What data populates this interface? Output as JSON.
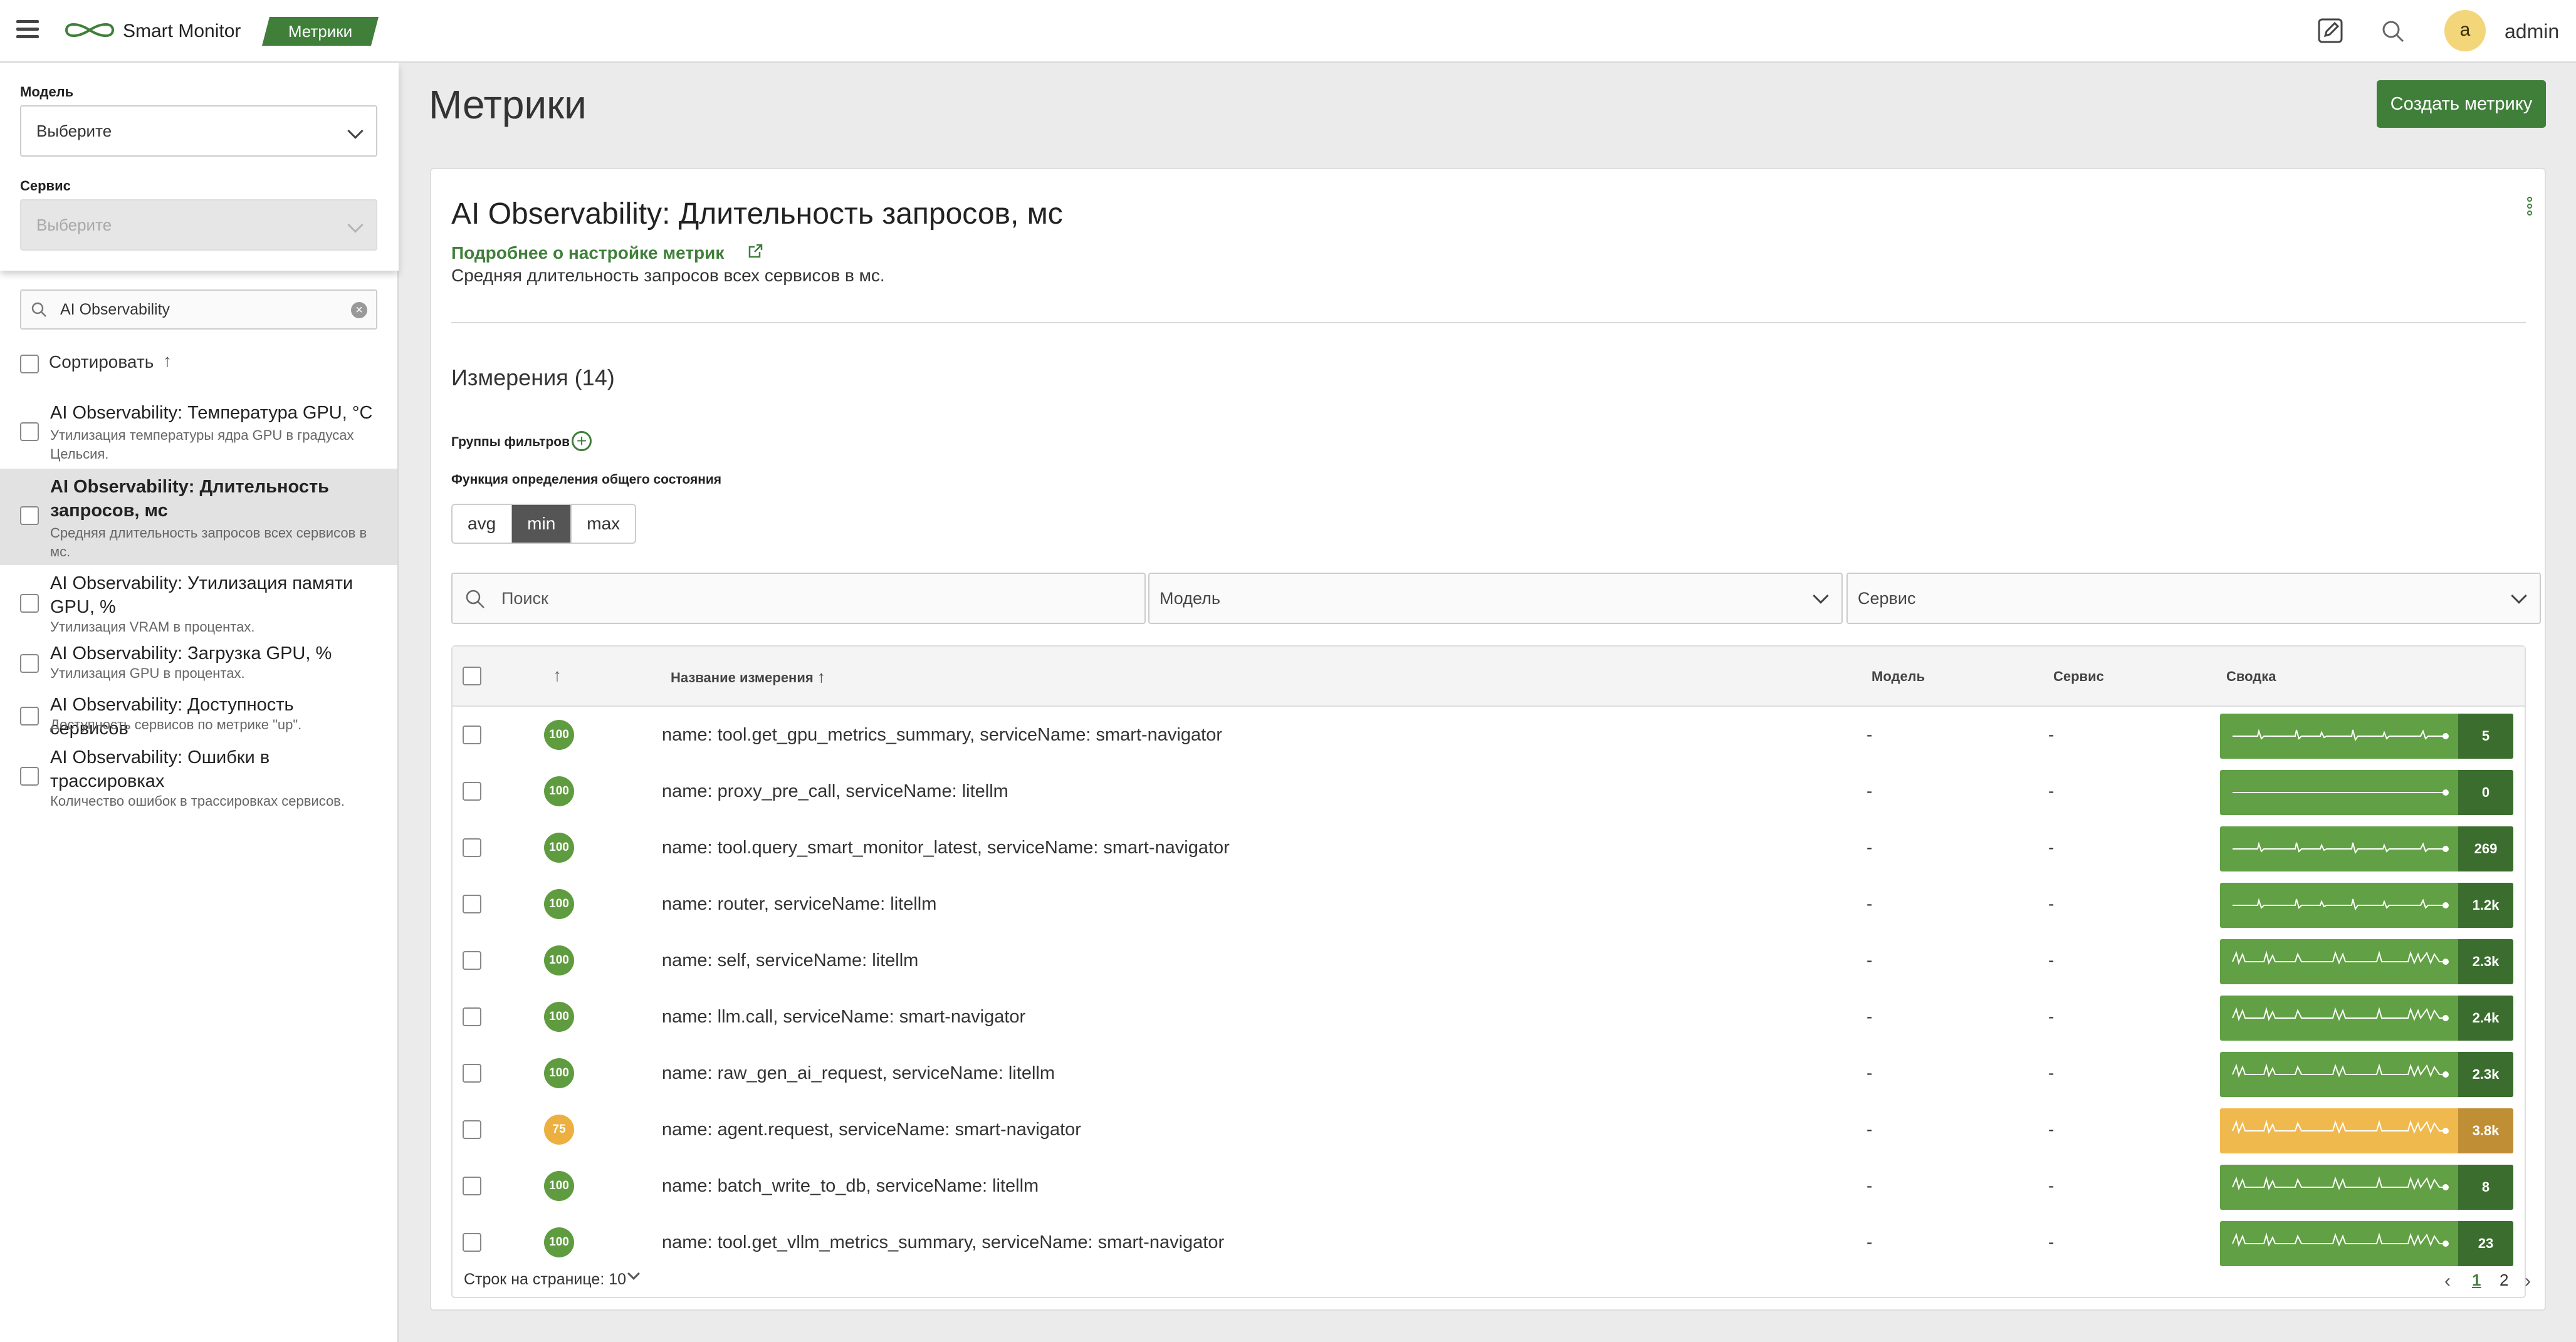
{
  "topbar": {
    "app_name": "Smart Monitor",
    "section_badge": "Метрики",
    "user_initial": "a",
    "user_name": "admin"
  },
  "sidebar": {
    "model_label": "Модель",
    "model_value": "Выберите",
    "service_label": "Сервис",
    "service_value": "Выберите",
    "search_value": "AI Observability",
    "sort_label": "Сортировать",
    "sort_arrow": "↑",
    "items": [
      {
        "title": "AI Observability: Температура GPU, °C",
        "desc": "Утилизация температуры ядра GPU в градусах Цельсия.",
        "active": false
      },
      {
        "title": "AI Observability: Длительность запросов, мс",
        "desc": "Средняя длительность запросов всех сервисов в мс.",
        "active": true
      },
      {
        "title": "AI Observability: Утилизация памяти GPU, %",
        "desc": "Утилизация VRAM в процентах.",
        "active": false
      },
      {
        "title": "AI Observability: Загрузка GPU, %",
        "desc": "Утилизация GPU в процентах.",
        "active": false
      },
      {
        "title": "AI Observability: Доступность сервисов",
        "desc": "Доступность сервисов по метрике \"up\".",
        "active": false
      },
      {
        "title": "AI Observability: Ошибки в трассировках",
        "desc": "Количество ошибок в трассировках сервисов.",
        "active": false
      }
    ]
  },
  "main": {
    "page_title": "Метрики",
    "create_button": "Создать метрику"
  },
  "metric": {
    "title": "AI Observability: Длительность запросов, мс",
    "settings_link": "Подробнее о настройке метрик",
    "description": "Средняя длительность запросов всех сервисов в мс.",
    "dimensions_title": "Измерения (14)",
    "filter_groups_label": "Группы фильтров",
    "state_function_label": "Функция определения общего состояния",
    "state_functions": [
      "avg",
      "min",
      "max"
    ],
    "state_function_selected": "min"
  },
  "filters": {
    "search_placeholder": "Поиск",
    "model_placeholder": "Модель",
    "service_placeholder": "Сервис"
  },
  "table": {
    "sort_arrow": "↑",
    "columns": {
      "name": "Название измерения",
      "name_sort": "↑",
      "model": "Модель",
      "service": "Сервис",
      "summary": "Сводка"
    },
    "rows": [
      {
        "score": "100",
        "name": "name: tool.get_gpu_metrics_summary, serviceName: smart-navigator",
        "model": "-",
        "service": "-",
        "summary": "5",
        "status": "ok"
      },
      {
        "score": "100",
        "name": "name: proxy_pre_call, serviceName: litellm",
        "model": "-",
        "service": "-",
        "summary": "0",
        "status": "ok"
      },
      {
        "score": "100",
        "name": "name: tool.query_smart_monitor_latest, serviceName: smart-navigator",
        "model": "-",
        "service": "-",
        "summary": "269",
        "status": "ok"
      },
      {
        "score": "100",
        "name": "name: router, serviceName: litellm",
        "model": "-",
        "service": "-",
        "summary": "1.2k",
        "status": "ok"
      },
      {
        "score": "100",
        "name": "name: self, serviceName: litellm",
        "model": "-",
        "service": "-",
        "summary": "2.3k",
        "status": "ok"
      },
      {
        "score": "100",
        "name": "name: llm.call, serviceName: smart-navigator",
        "model": "-",
        "service": "-",
        "summary": "2.4k",
        "status": "ok"
      },
      {
        "score": "100",
        "name": "name: raw_gen_ai_request, serviceName: litellm",
        "model": "-",
        "service": "-",
        "summary": "2.3k",
        "status": "ok"
      },
      {
        "score": "75",
        "name": "name: agent.request, serviceName: smart-navigator",
        "model": "-",
        "service": "-",
        "summary": "3.8k",
        "status": "warn"
      },
      {
        "score": "100",
        "name": "name: batch_write_to_db, serviceName: litellm",
        "model": "-",
        "service": "-",
        "summary": "8",
        "status": "ok"
      },
      {
        "score": "100",
        "name": "name: tool.get_vllm_metrics_summary, serviceName: smart-navigator",
        "model": "-",
        "service": "-",
        "summary": "23",
        "status": "ok"
      }
    ]
  },
  "pagination": {
    "rows_per_page": "Строк на странице: 10",
    "pages": [
      "1",
      "2"
    ],
    "current_page": "1"
  },
  "colors": {
    "brand": "#3f7f3a",
    "ok": "#61a044",
    "ok_score": "#5f9b3f",
    "warn": "#f0b94e",
    "warn_score": "#ebb040"
  }
}
